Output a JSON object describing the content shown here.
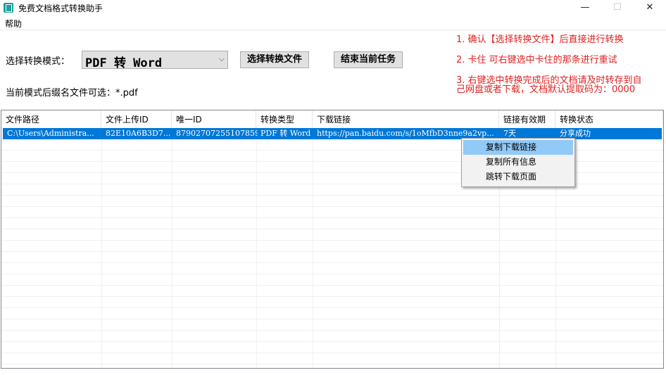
{
  "window": {
    "title": "免费文档格式转换助手",
    "minimize": "—",
    "maximize": "☐",
    "close": "✕"
  },
  "menu": {
    "help": "帮助"
  },
  "controls": {
    "mode_label": "选择转换模式：",
    "mode_value": "PDF 转 Word",
    "mode_arrow": "⌵",
    "select_file_button": "选择转换文件",
    "end_task_button": "结束当前任务",
    "suffix_label": "当前模式后缀名文件可选：*.pdf"
  },
  "instructions": {
    "line1": "1.  确认【选择转换文件】后直接进行转换",
    "line2": "2.  卡住  可右键选中卡住的那条进行重试",
    "line3a": "3.  右键选中转换完成后的文档请及时转存到自",
    "line3b": "己网盘或者下载，文档默认提取码为：0000"
  },
  "table": {
    "headers": [
      "文件路径",
      "文件上传ID",
      "唯一ID",
      "转换类型",
      "下载链接",
      "链接有效期",
      "转换状态"
    ],
    "rows": [
      [
        "C:\\Users\\Administra...",
        "82E10A6B3D7...",
        "87902707255107859",
        "PDF 转 Word",
        "https://pan.baidu.com/s/1oMfbD3nne9a2vp...",
        "7天",
        "分享成功"
      ]
    ]
  },
  "context_menu": {
    "items": [
      "复制下载链接",
      "复制所有信息",
      "跳转下载页面"
    ]
  },
  "colors": {
    "instruction_text": "#e02020",
    "selection": "#0078d7",
    "menu_highlight": "#91c9f7",
    "app_icon": "#1aa1a0"
  }
}
